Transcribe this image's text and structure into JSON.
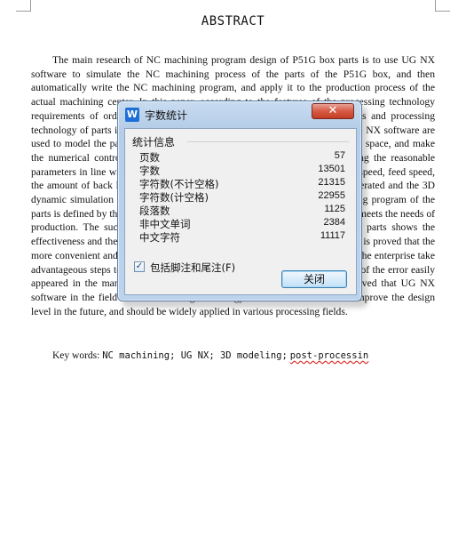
{
  "document": {
    "title": "ABSTRACT",
    "abstract_text": "The main research of NC machining program design of P51G box parts is to use UG NX software to simulate the NC machining process of the parts of the P51G box, and then automatically write the NC machining program, and apply it to the production process of the actual machining center. In this paper, according to the features of the processing technology requirements of ordinary box parts, the processing route of P51G box parts and processing technology of parts is formulated, and the modeling and CAM functions of UG NX software are used to model the parts and simulate the processing process of the parts in 3D space, and make the numerical control processing of the box parts more reasonable by setting the reasonable parameters in line with the requirements of actual processing, such as spindle speed, feed speed, the amount of back knife and so on. The cutter location file of the part is generated and the 3D dynamic simulation of the machining process is carried out, and the machining program of the parts is defined by the post-processing and the NC program is generated which meets the needs of production. The successful design of NC machining program of P51G box parts shows the effectiveness and the feasibility of automatic programming based on UG NX. It is proved that the more convenient and quick machining methods can be produced, and it makes the enterprise take advantageous steps to save more manpower and material resources and get rid of the error easily appeared in the manual programming of large and complex parts. It is believed that UG NX software in the field of NC machining technology will be the main tool to improve the design level in the future, and should be widely applied in various processing fields.",
    "keywords_label": "Key words:",
    "keywords_text": "NC machining; UG NX; 3D modeling;",
    "keywords_last": "post-processin"
  },
  "dialog": {
    "app_icon_glyph": "W",
    "title": "字数统计",
    "close_x": "✕",
    "group_label": "统计信息",
    "stats": [
      {
        "label": "页数",
        "value": "57"
      },
      {
        "label": "字数",
        "value": "13501"
      },
      {
        "label": "字符数(不计空格)",
        "value": "21315"
      },
      {
        "label": "字符数(计空格)",
        "value": "22955"
      },
      {
        "label": "段落数",
        "value": "1125"
      },
      {
        "label": "非中文单词",
        "value": "2384"
      },
      {
        "label": "中文字符",
        "value": "11117"
      }
    ],
    "checkbox_label": "包括脚注和尾注(F)",
    "checkbox_checked": true,
    "checkbox_mark": "✓",
    "close_button": "关闭"
  }
}
